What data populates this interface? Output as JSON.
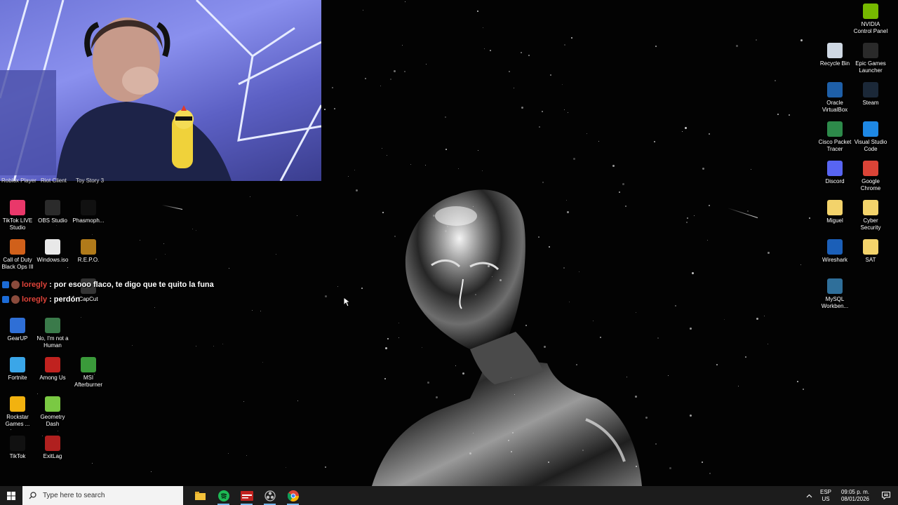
{
  "chat": [
    {
      "user": "loregly",
      "message": ": por esooo flaco, te digo que te quito la funa"
    },
    {
      "user": "loregly",
      "message": ": perdón"
    }
  ],
  "icons_partial_top": [
    "Roblox Player",
    "Riot Client",
    "Toy Story 3"
  ],
  "left_icons": [
    {
      "label": "TikTok LIVE\nStudio",
      "icon": "tiktok-live-icon",
      "color": "#e9386a"
    },
    {
      "label": "OBS Studio",
      "icon": "obs-icon",
      "color": "#2b2b2b"
    },
    {
      "label": "Phasmoph...",
      "icon": "phasmophobia-icon",
      "color": "#111111"
    },
    {
      "label": "Call of Duty\nBlack Ops III",
      "icon": "cod-icon",
      "color": "#d0601a"
    },
    {
      "label": "Windows.iso",
      "icon": "disc-file-icon",
      "color": "#e8e8e8"
    },
    {
      "label": "R.E.P.O.",
      "icon": "repo-icon",
      "color": "#b07a1a"
    },
    {
      "label": "CapCut",
      "icon": "capcut-icon",
      "color": "#333333"
    },
    {
      "label": "GearUP",
      "icon": "gearup-icon",
      "color": "#2f6fd6"
    },
    {
      "label": "No, I'm not a\nHuman",
      "icon": "no-im-not-human-icon",
      "color": "#3a7a4a"
    },
    {
      "label": "Fortnite",
      "icon": "fortnite-icon",
      "color": "#3aa6e8"
    },
    {
      "label": "Among Us",
      "icon": "among-us-icon",
      "color": "#c0221f"
    },
    {
      "label": "MSI\nAfterburner",
      "icon": "msi-afterburner-icon",
      "color": "#3a9a3a"
    },
    {
      "label": "Rockstar\nGames ...",
      "icon": "rockstar-icon",
      "color": "#f2b20f"
    },
    {
      "label": "Geometry\nDash",
      "icon": "geometry-dash-icon",
      "color": "#7ac943"
    },
    {
      "label": "TikTok",
      "icon": "tiktok-icon",
      "color": "#111111"
    },
    {
      "label": "ExitLag",
      "icon": "exitlag-icon",
      "color": "#b0201f"
    }
  ],
  "right_icons": [
    {
      "label": "NVIDIA\nControl Panel",
      "icon": "nvidia-icon",
      "color": "#76b900"
    },
    {
      "label": "Recycle Bin",
      "icon": "recycle-bin-icon",
      "color": "#cfd8e3"
    },
    {
      "label": "Epic Games\nLauncher",
      "icon": "epic-games-icon",
      "color": "#2a2a2a"
    },
    {
      "label": "Oracle\nVirtualBox",
      "icon": "virtualbox-icon",
      "color": "#1e5fa8"
    },
    {
      "label": "Steam",
      "icon": "steam-icon",
      "color": "#1b2838"
    },
    {
      "label": "Cisco Packet\nTracer",
      "icon": "cisco-packet-tracer-icon",
      "color": "#2d8a4a"
    },
    {
      "label": "Visual Studio\nCode",
      "icon": "vscode-icon",
      "color": "#1e88e5"
    },
    {
      "label": "Discord",
      "icon": "discord-icon",
      "color": "#5865f2"
    },
    {
      "label": "Google\nChrome",
      "icon": "chrome-icon",
      "color": "#db4437"
    },
    {
      "label": "Miguel",
      "icon": "folder-doc-icon",
      "color": "#f3d36b"
    },
    {
      "label": "Cyber\nSecurity",
      "icon": "folder-doc-icon",
      "color": "#f3d36b"
    },
    {
      "label": "Wireshark",
      "icon": "wireshark-icon",
      "color": "#1b5fb8"
    },
    {
      "label": "SAT",
      "icon": "folder-doc-icon",
      "color": "#f3d36b"
    },
    {
      "label": "MySQL\nWorkben...",
      "icon": "mysql-workbench-icon",
      "color": "#2f6f9a"
    }
  ],
  "taskbar": {
    "search_placeholder": "Type here to search",
    "apps": [
      {
        "name": "file-explorer-icon",
        "color": "#f3c13a"
      },
      {
        "name": "spotify-icon",
        "color": "#1db954"
      },
      {
        "name": "video-editor-icon",
        "color": "#c0221f"
      },
      {
        "name": "obs-icon",
        "color": "#aaaaaa"
      },
      {
        "name": "chrome-icon",
        "color": "#db4437"
      }
    ],
    "lang_top": "ESP",
    "lang_bottom": "US",
    "time": "09:05 p. m.",
    "date": "08/01/2026"
  }
}
